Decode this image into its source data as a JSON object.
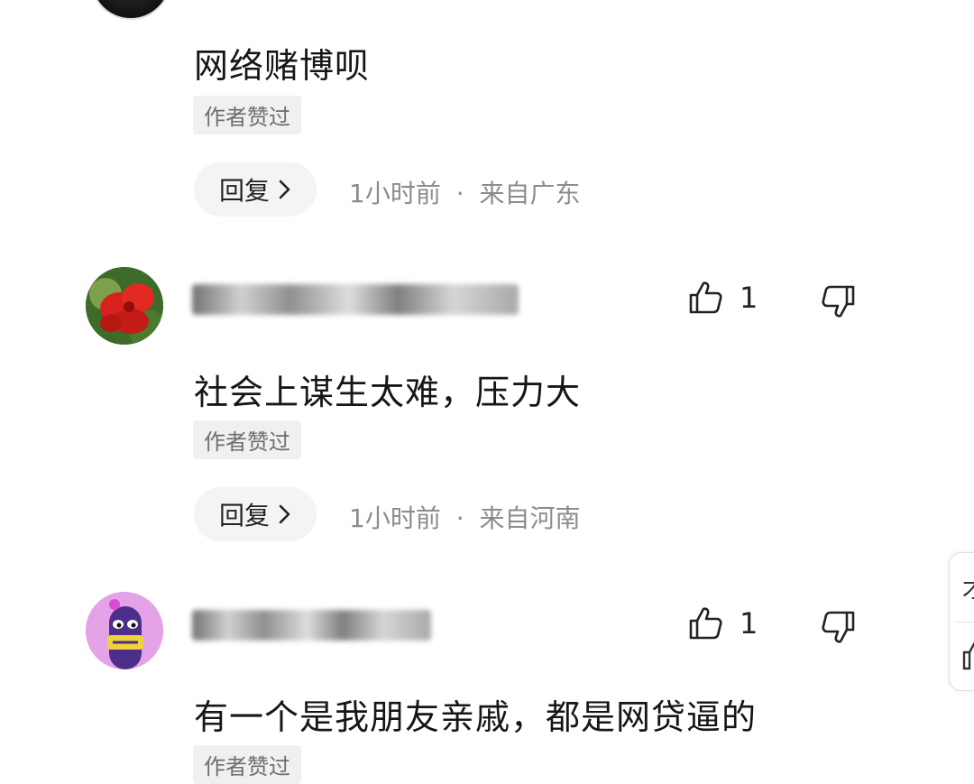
{
  "comments": [
    {
      "text": "网络赌博呗",
      "badge": "作者赞过",
      "reply_label": "回复",
      "time": "1小时前",
      "location": "来自广东"
    },
    {
      "username": "",
      "text": "社会上谋生太难，压力大",
      "badge": "作者赞过",
      "reply_label": "回复",
      "time": "1小时前",
      "location": "来自河南",
      "like_count": "1"
    },
    {
      "username": "",
      "text": "有一个是我朋友亲戚，都是网贷逼的",
      "badge": "作者赞过",
      "like_count": "1"
    }
  ],
  "meta_separator": "·",
  "side_widget": {
    "label": "才"
  },
  "icons": {
    "like": "thumbs-up-icon",
    "dislike": "thumbs-down-icon",
    "reply_arrow": "chevron-right-icon"
  }
}
